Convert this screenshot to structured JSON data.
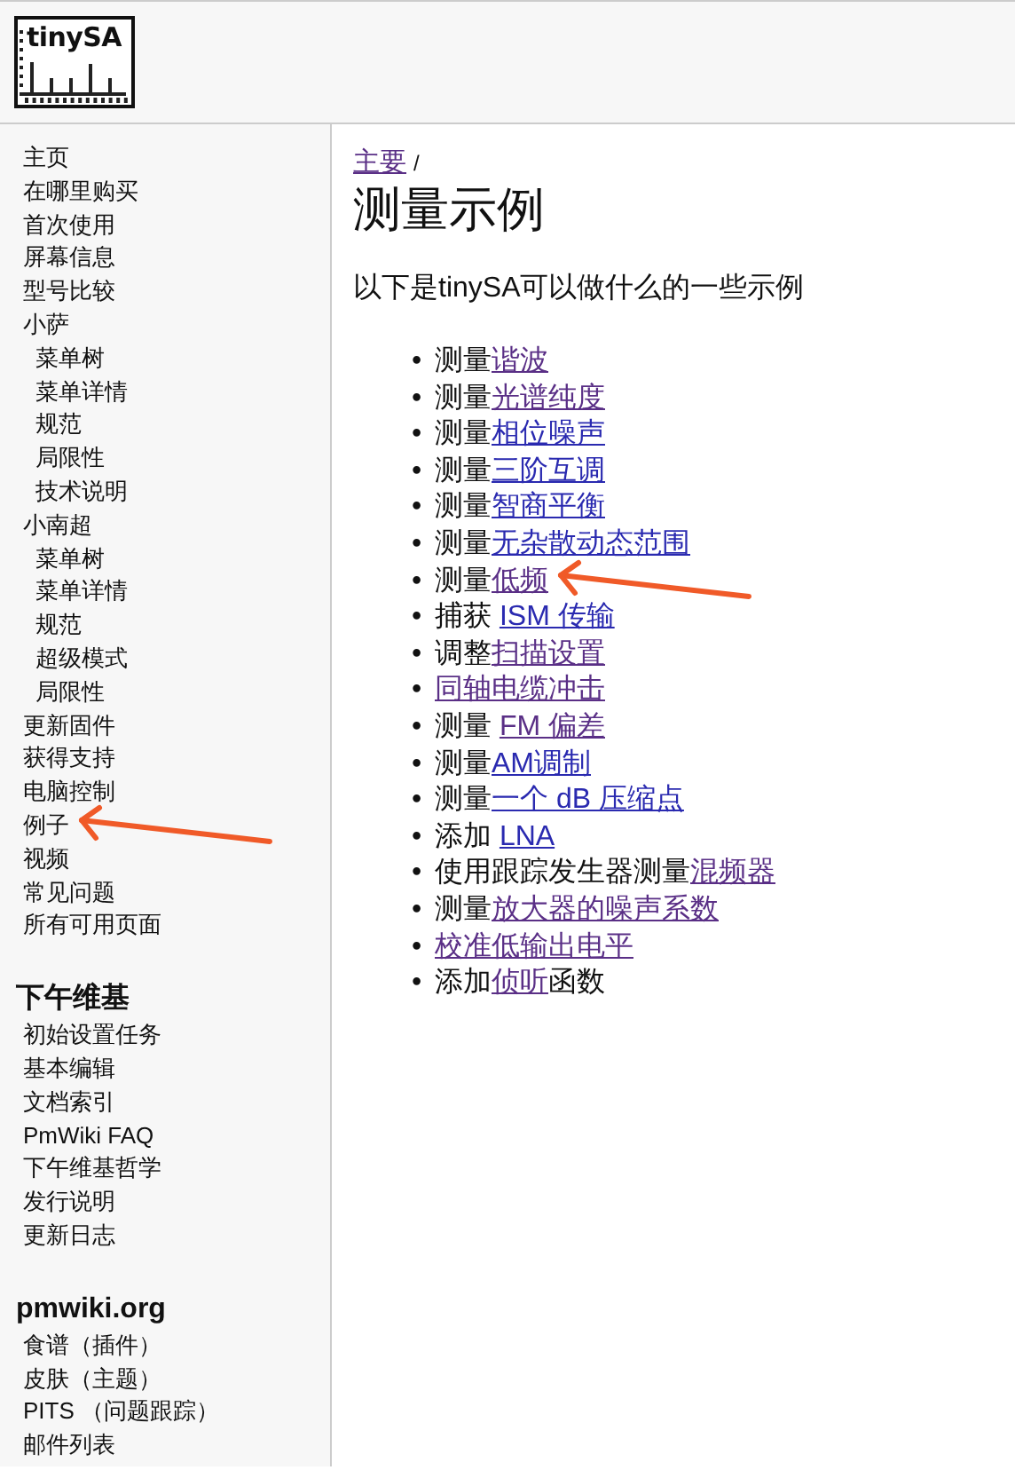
{
  "logo": {
    "text": "tinySA"
  },
  "sidebar": {
    "items": [
      {
        "label": "主页",
        "marked": false
      },
      {
        "label": "在哪里购买",
        "marked": false
      },
      {
        "label": "首次使用",
        "marked": false
      },
      {
        "label": "屏幕信息",
        "marked": false
      },
      {
        "label": "型号比较",
        "marked": false
      },
      {
        "label": "小萨",
        "marked": false,
        "children": [
          {
            "label": "菜单树",
            "marked": false
          },
          {
            "label": "菜单详情",
            "marked": false
          },
          {
            "label": "规范",
            "marked": false
          },
          {
            "label": "局限性",
            "marked": false
          },
          {
            "label": "技术说明",
            "marked": false
          }
        ]
      },
      {
        "label": "小南超",
        "marked": false,
        "children": [
          {
            "label": "菜单树",
            "marked": false
          },
          {
            "label": "菜单详情",
            "marked": false
          },
          {
            "label": "规范",
            "marked": false
          },
          {
            "label": "超级模式",
            "marked": false
          },
          {
            "label": "局限性",
            "marked": false
          }
        ]
      },
      {
        "label": "更新固件",
        "marked": false
      },
      {
        "label": "获得支持",
        "marked": false
      },
      {
        "label": "电脑控制",
        "marked": false
      },
      {
        "label": "例子",
        "marked": true
      },
      {
        "label": "视频",
        "marked": false
      },
      {
        "label": "常见问题",
        "marked": false
      },
      {
        "label": "所有可用页面",
        "marked": false
      }
    ],
    "sections": [
      {
        "heading": "下午维基",
        "items": [
          "初始设置任务",
          "基本编辑",
          "文档索引",
          "PmWiki FAQ",
          "下午维基哲学",
          "发行说明",
          "更新日志"
        ]
      },
      {
        "heading": "pmwiki.org",
        "items": [
          "食谱（插件）",
          "皮肤（主题）",
          "PITS （问题跟踪）",
          "邮件列表"
        ]
      }
    ]
  },
  "main": {
    "breadcrumb": {
      "link": "主要",
      "separator": "/"
    },
    "title": "测量示例",
    "intro": "以下是tinySA可以做什么的一些示例",
    "marker": "•",
    "examples": [
      {
        "prefix": "测量",
        "link": "谐波",
        "visited": true,
        "marked": false
      },
      {
        "prefix": "测量",
        "link": "光谱纯度",
        "visited": true,
        "marked": false
      },
      {
        "prefix": "测量",
        "link": "相位噪声",
        "visited": false,
        "marked": false
      },
      {
        "prefix": "测量",
        "link": "三阶互调",
        "visited": false,
        "marked": false
      },
      {
        "prefix": "测量",
        "link": "智商平衡",
        "visited": false,
        "marked": false
      },
      {
        "prefix": "测量",
        "link": "无杂散动态范围",
        "visited": false,
        "marked": false
      },
      {
        "prefix": "测量",
        "link": "低频",
        "visited": true,
        "marked": true
      },
      {
        "prefix": "捕获 ",
        "link": "ISM 传输",
        "visited": false,
        "marked": false
      },
      {
        "prefix": "调整",
        "link": "扫描设置",
        "visited": true,
        "marked": false
      },
      {
        "link": "同轴电缆冲击",
        "visited": true,
        "marked": false
      },
      {
        "prefix": "测量 ",
        "link": "FM 偏差",
        "visited": true,
        "marked": false
      },
      {
        "prefix": "测量",
        "link": "AM调制",
        "visited": false,
        "marked": false
      },
      {
        "prefix": "测量",
        "link": "一个 dB 压缩点",
        "visited": false,
        "marked": false
      },
      {
        "prefix": "添加 ",
        "link": "LNA",
        "visited": false,
        "marked": false
      },
      {
        "prefix": "使用跟踪发生器测量",
        "link": "混频器",
        "visited": true,
        "marked": false
      },
      {
        "prefix": "测量",
        "link": "放大器的噪声系数",
        "visited": true,
        "marked": false
      },
      {
        "link": "校准低输出电平",
        "visited": true,
        "marked": false
      },
      {
        "prefix": "添加",
        "link": "侦听",
        "suffix": "函数",
        "visited": true,
        "marked": false
      }
    ]
  }
}
